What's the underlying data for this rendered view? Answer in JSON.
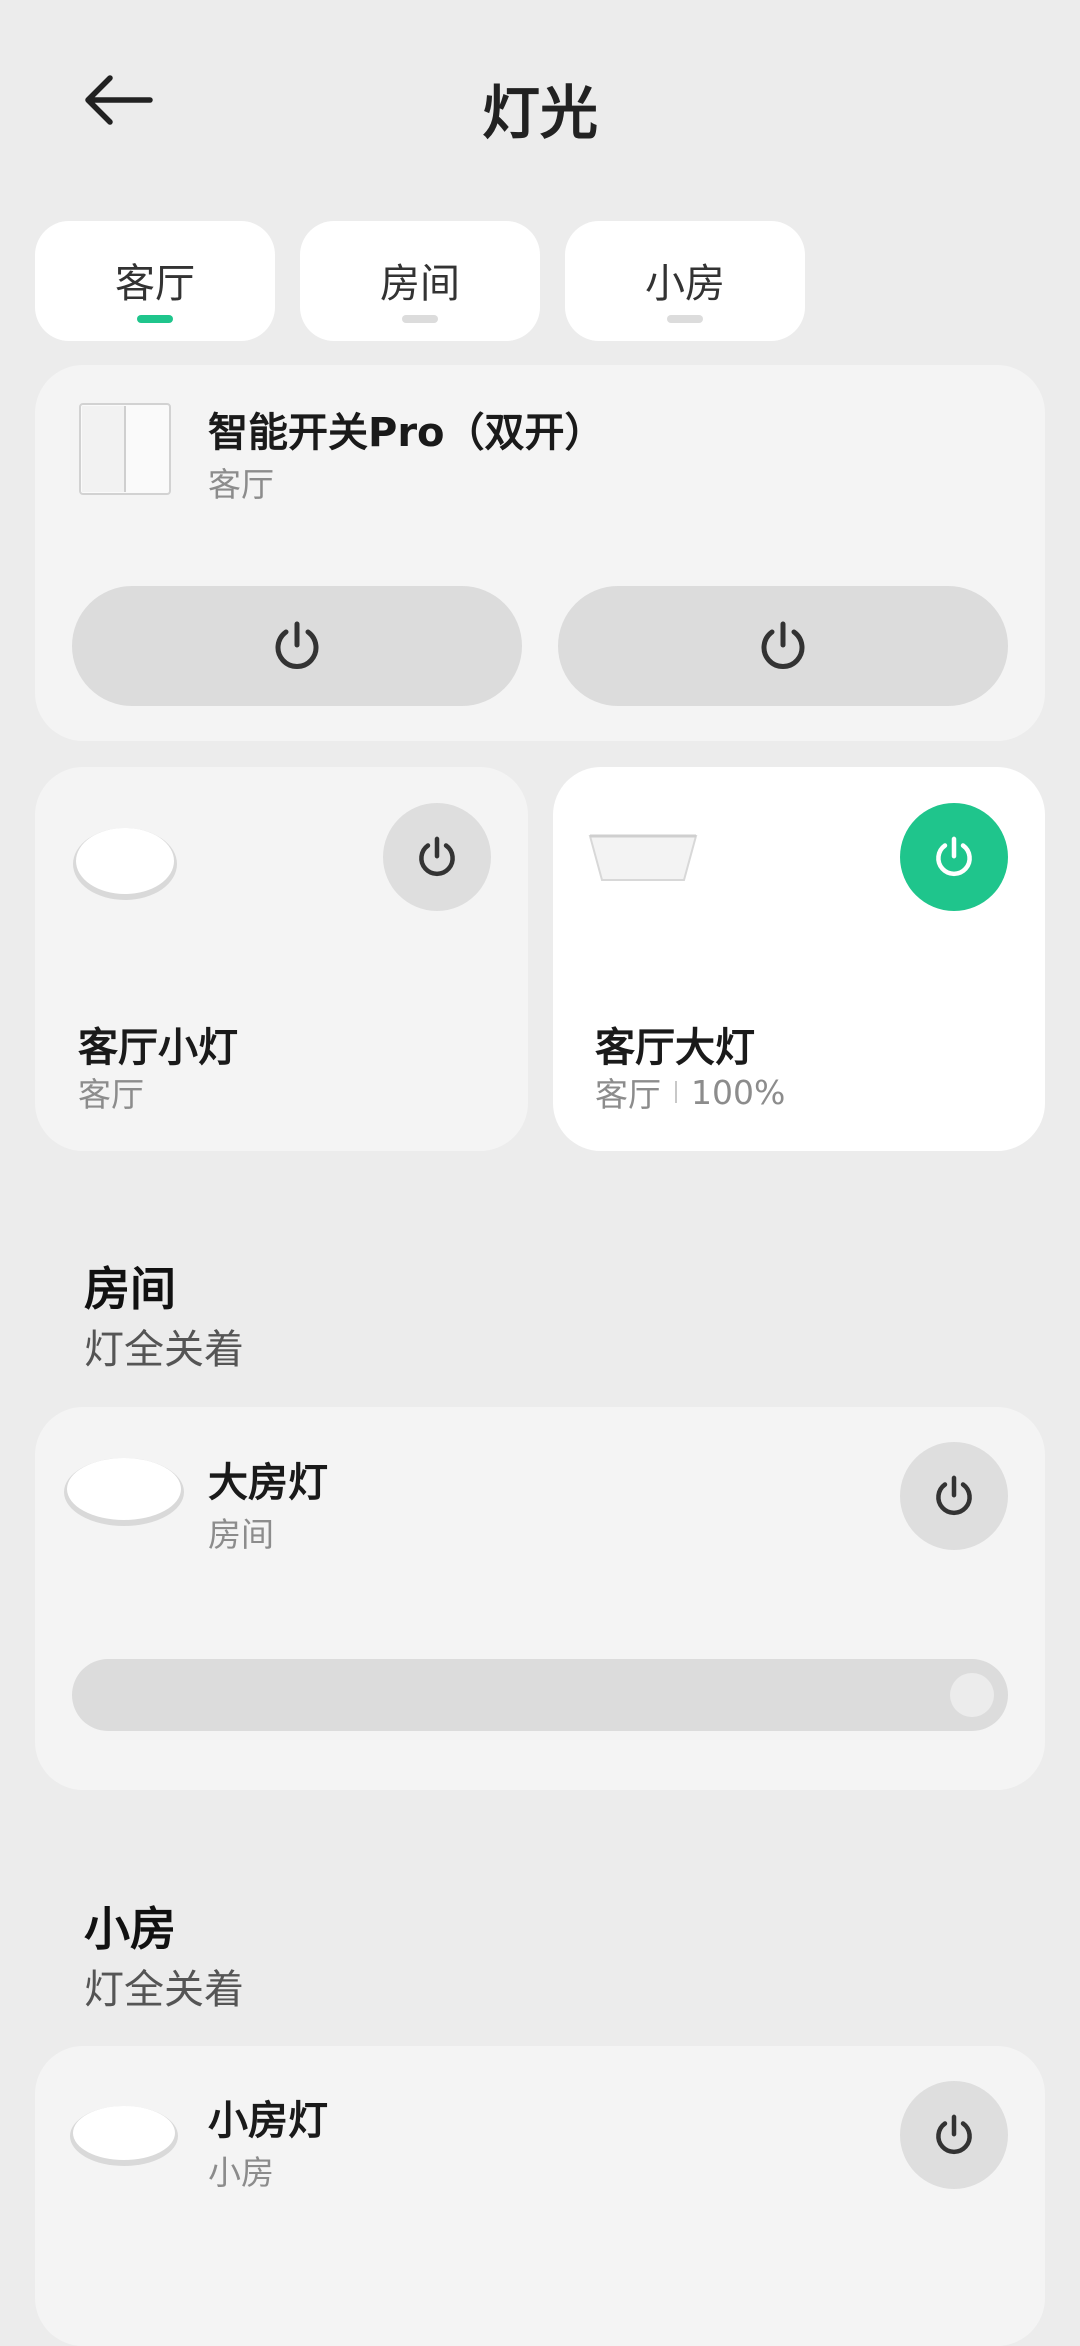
{
  "header": {
    "title": "灯光"
  },
  "tabs": [
    {
      "label": "客厅",
      "active": true
    },
    {
      "label": "房间",
      "active": false
    },
    {
      "label": "小房",
      "active": false
    }
  ],
  "switch_card": {
    "name": "智能开关Pro（双开）",
    "room": "客厅"
  },
  "small_light": {
    "name": "客厅小灯",
    "room": "客厅",
    "on": false
  },
  "big_light": {
    "name": "客厅大灯",
    "room": "客厅",
    "brightness": "100%",
    "on": true
  },
  "room_section": {
    "title": "房间",
    "status": "灯全关着"
  },
  "room_light": {
    "name": "大房灯",
    "room": "房间",
    "on": false
  },
  "small_section": {
    "title": "小房",
    "status": "灯全关着"
  },
  "small_room_light": {
    "name": "小房灯",
    "room": "小房",
    "on": false
  },
  "colors": {
    "accent": "#1fc58c",
    "background": "#ececec"
  }
}
